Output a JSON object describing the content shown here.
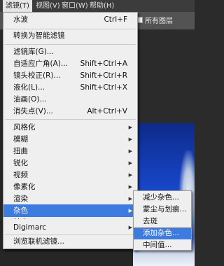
{
  "menubar": {
    "items": [
      {
        "label": "滤镜(T)",
        "active": true
      },
      {
        "label": "视图(V)",
        "active": false
      },
      {
        "label": "窗口(W)",
        "active": false
      },
      {
        "label": "帮助(H)",
        "active": false
      }
    ]
  },
  "options_bar": {
    "checkbox_label": "所有图层"
  },
  "filter_menu": {
    "items": [
      {
        "label": "水波",
        "shortcut": "Ctrl+F"
      },
      {
        "label": "转换为智能滤镜"
      },
      {
        "label": "滤镜库(G)..."
      },
      {
        "label": "自适应广角(A)...",
        "shortcut": "Shift+Ctrl+A"
      },
      {
        "label": "镜头校正(R)...",
        "shortcut": "Shift+Ctrl+R"
      },
      {
        "label": "液化(L)...",
        "shortcut": "Shift+Ctrl+X"
      },
      {
        "label": "油画(O)..."
      },
      {
        "label": "消失点(V)...",
        "shortcut": "Alt+Ctrl+V"
      },
      {
        "label": "风格化",
        "submenu": true
      },
      {
        "label": "模糊",
        "submenu": true
      },
      {
        "label": "扭曲",
        "submenu": true
      },
      {
        "label": "锐化",
        "submenu": true
      },
      {
        "label": "视频",
        "submenu": true
      },
      {
        "label": "像素化",
        "submenu": true
      },
      {
        "label": "渲染",
        "submenu": true
      },
      {
        "label": "杂色",
        "submenu": true,
        "highlighted": true
      },
      {
        "label": "其它",
        "submenu": true
      },
      {
        "label": "Digimarc",
        "submenu": true
      },
      {
        "label": "浏览联机滤镜..."
      }
    ]
  },
  "noise_submenu": {
    "items": [
      {
        "label": "减少杂色..."
      },
      {
        "label": "蒙尘与划痕..."
      },
      {
        "label": "去斑"
      },
      {
        "label": "添加杂色...",
        "highlighted": true
      },
      {
        "label": "中间值..."
      }
    ]
  },
  "colors": {
    "highlight": "#3c7be0",
    "menu_bg": "#efefef",
    "app_bg": "#2b2b2b"
  }
}
